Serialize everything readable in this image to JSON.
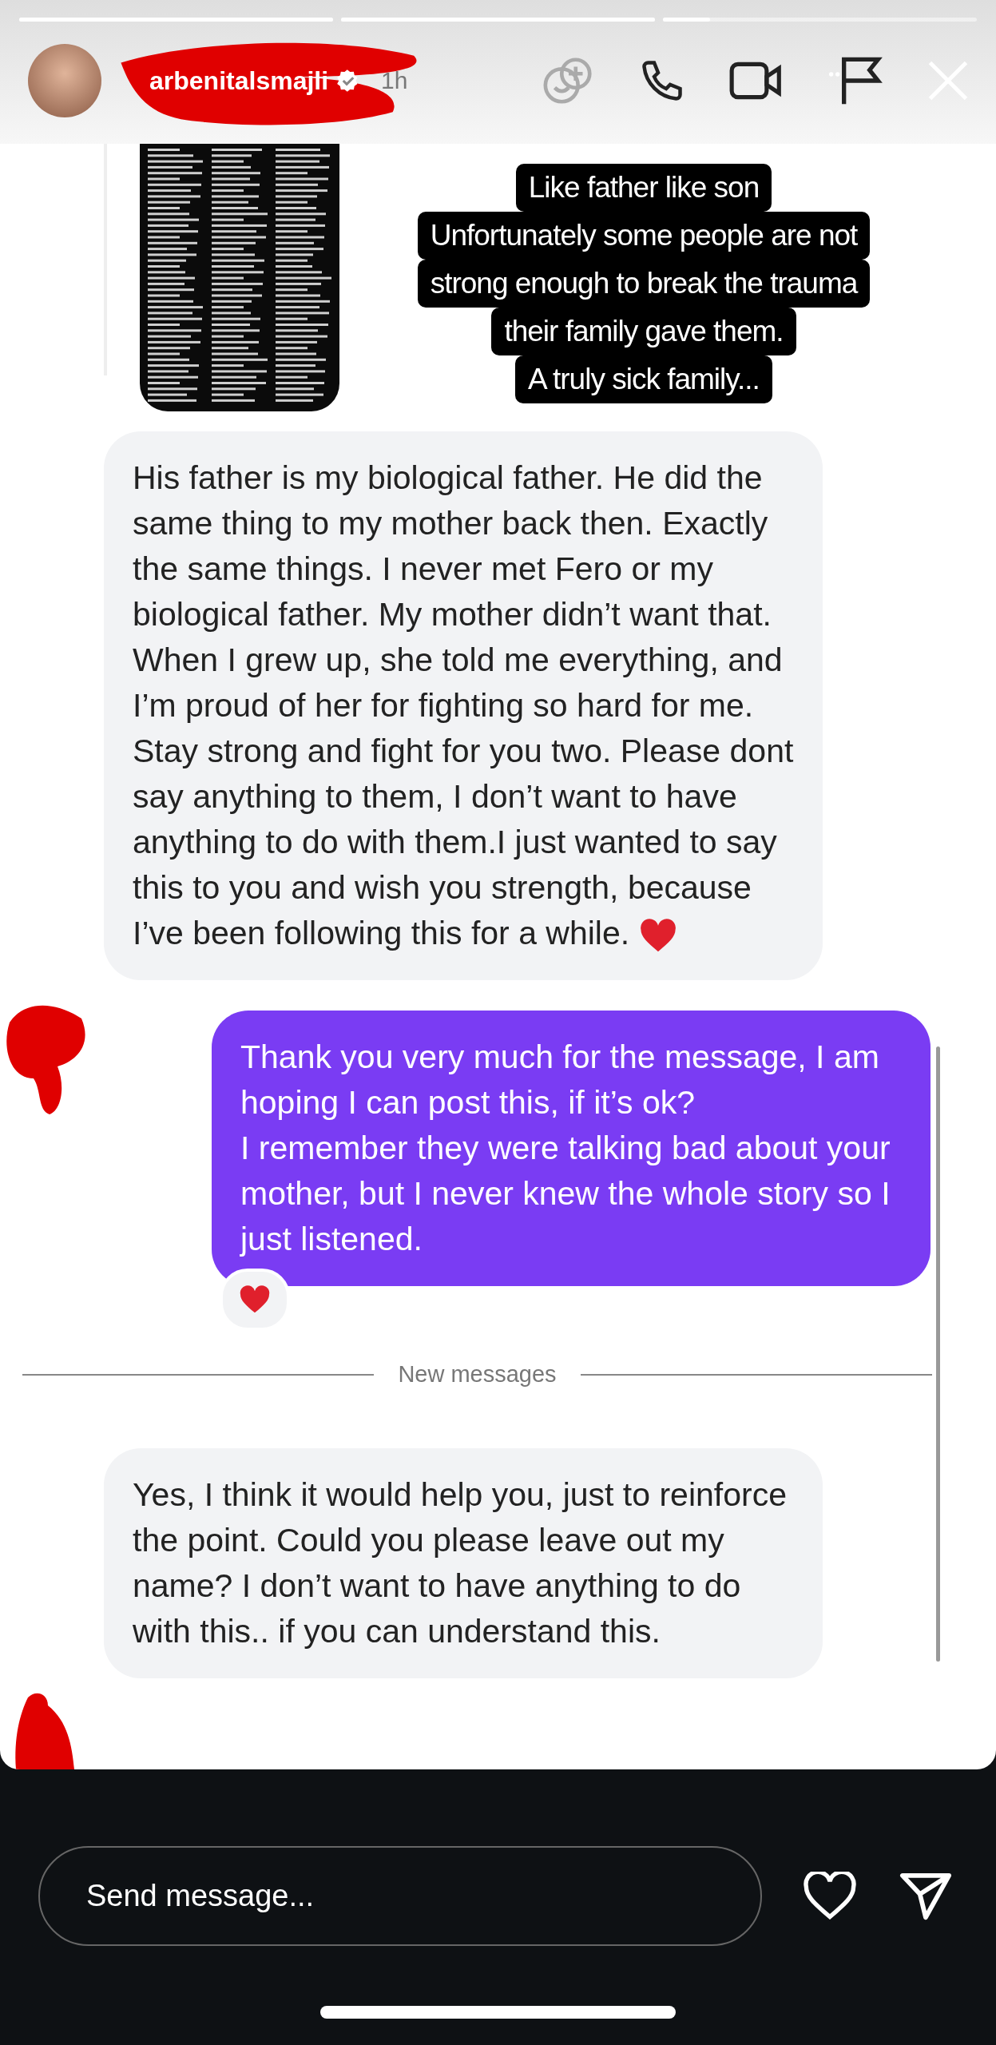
{
  "story": {
    "progress": [
      {
        "level": 1
      },
      {
        "level": 1
      },
      {
        "level": 0.15
      }
    ]
  },
  "header": {
    "username": "arbenitalsmajli",
    "verified": true,
    "time": "1h"
  },
  "shared_post": {
    "caption_lines": [
      "Like father like son",
      "Unfortunately some people are not",
      "strong enough to break the trauma",
      "their family gave them.",
      "A truly sick family..."
    ]
  },
  "messages": [
    {
      "kind": "received",
      "text": "His father is my biological father. He did the same thing to my mother back then. Exactly the same things. I never met Fero or my biological father. My mother didn’t want that. When I grew up, she told me everything, and I’m proud of her for fighting so hard for me. Stay strong and fight for you two. Please dont say anything to them, I don’t want to have anything to do with them.I just wanted to say this to you and wish you strength, because I’ve been following this for a while.",
      "heart": true
    },
    {
      "kind": "sent",
      "text": "Thank you very much for the message, I am hoping I can post this, if it’s ok?\nI remember they were talking bad about your mother, but I never knew the whole story so I just listened.",
      "reaction": true
    },
    {
      "kind": "divider",
      "text": "New messages"
    },
    {
      "kind": "received",
      "text": "Yes, I think it would help you, just to reinforce the point. Could you please leave out my name? I don’t want to have anything to do with this.. if you can understand this.",
      "heart": false
    }
  ],
  "composer": {
    "placeholder": "Send message..."
  }
}
